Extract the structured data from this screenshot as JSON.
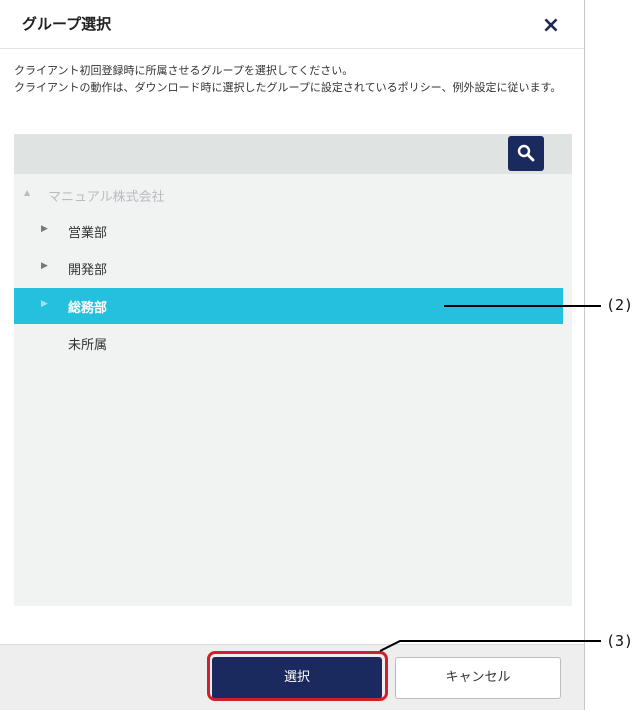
{
  "dialog": {
    "title": "グループ選択",
    "close_icon": "×",
    "description": [
      "クライアント初回登録時に所属させるグループを選択してください。",
      "クライアントの動作は、ダウンロード時に選択したグループに設定されているポリシー、例外設定に従います。"
    ]
  },
  "tree": {
    "root": {
      "label": "マニュアル株式会社",
      "expanded": true
    },
    "children": [
      {
        "label": "営業部",
        "expandable": true,
        "selected": false
      },
      {
        "label": "開発部",
        "expandable": true,
        "selected": false
      },
      {
        "label": "総務部",
        "expandable": true,
        "selected": true
      },
      {
        "label": "未所属",
        "expandable": false,
        "selected": false
      }
    ]
  },
  "icons": {
    "search": "search-icon",
    "caret_right": "▶",
    "caret_down": "▲"
  },
  "buttons": {
    "select_label": "選択",
    "cancel_label": "キャンセル"
  },
  "callouts": {
    "c2": "(2)",
    "c3": "(3)"
  },
  "colors": {
    "accent": "#1b2a5e",
    "selection": "#24c0dd",
    "highlight": "#d0202f"
  }
}
